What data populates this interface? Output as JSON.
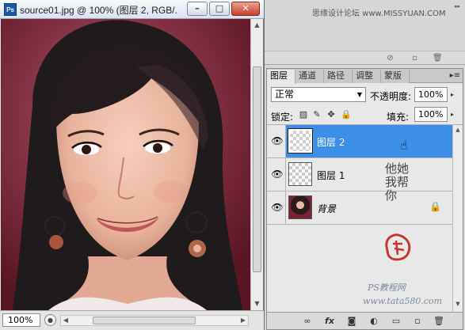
{
  "document": {
    "badge": "Ps",
    "title": "source01.jpg @ 100% (图层 2, RGB/...",
    "min_label": "–",
    "max_label": "□",
    "close_label": "✕",
    "zoom": "100%"
  },
  "top_watermark": "思缘设计论坛 www.MISSYUAN.COM",
  "layers_panel": {
    "tabs": [
      "图层",
      "通道",
      "路径",
      "调整",
      "蒙版"
    ],
    "active_tab": 0,
    "blend_mode": "正常",
    "opacity_label": "不透明度:",
    "opacity": "100%",
    "lock_label": "锁定:",
    "fill_label": "填充:",
    "fill": "100%",
    "layers": [
      {
        "name": "图层 2",
        "selected": true,
        "visible": true,
        "thumbnail": "transparent"
      },
      {
        "name": "图层 1",
        "selected": false,
        "visible": true,
        "thumbnail": "transparent"
      },
      {
        "name": "背景",
        "selected": false,
        "visible": true,
        "thumbnail": "photo",
        "locked": true
      }
    ]
  },
  "canvas_watermark": {
    "calligraphy": "他她我帮你",
    "site_name": "PS教程网",
    "url": "www.tata580.com"
  },
  "icons": {
    "eye": "eye-icon",
    "lock": "lock-icon",
    "link": "link-icon",
    "fx": "fx-icon",
    "mask": "mask-icon",
    "adjustment": "adjustment-icon",
    "folder": "folder-icon",
    "new_layer": "new-layer-icon",
    "trash": "trash-icon"
  },
  "colors": {
    "selection": "#3d8ee6",
    "backdrop": "#7a2232",
    "hair": "#1f1a1c",
    "skin": "#f0c3ae"
  }
}
